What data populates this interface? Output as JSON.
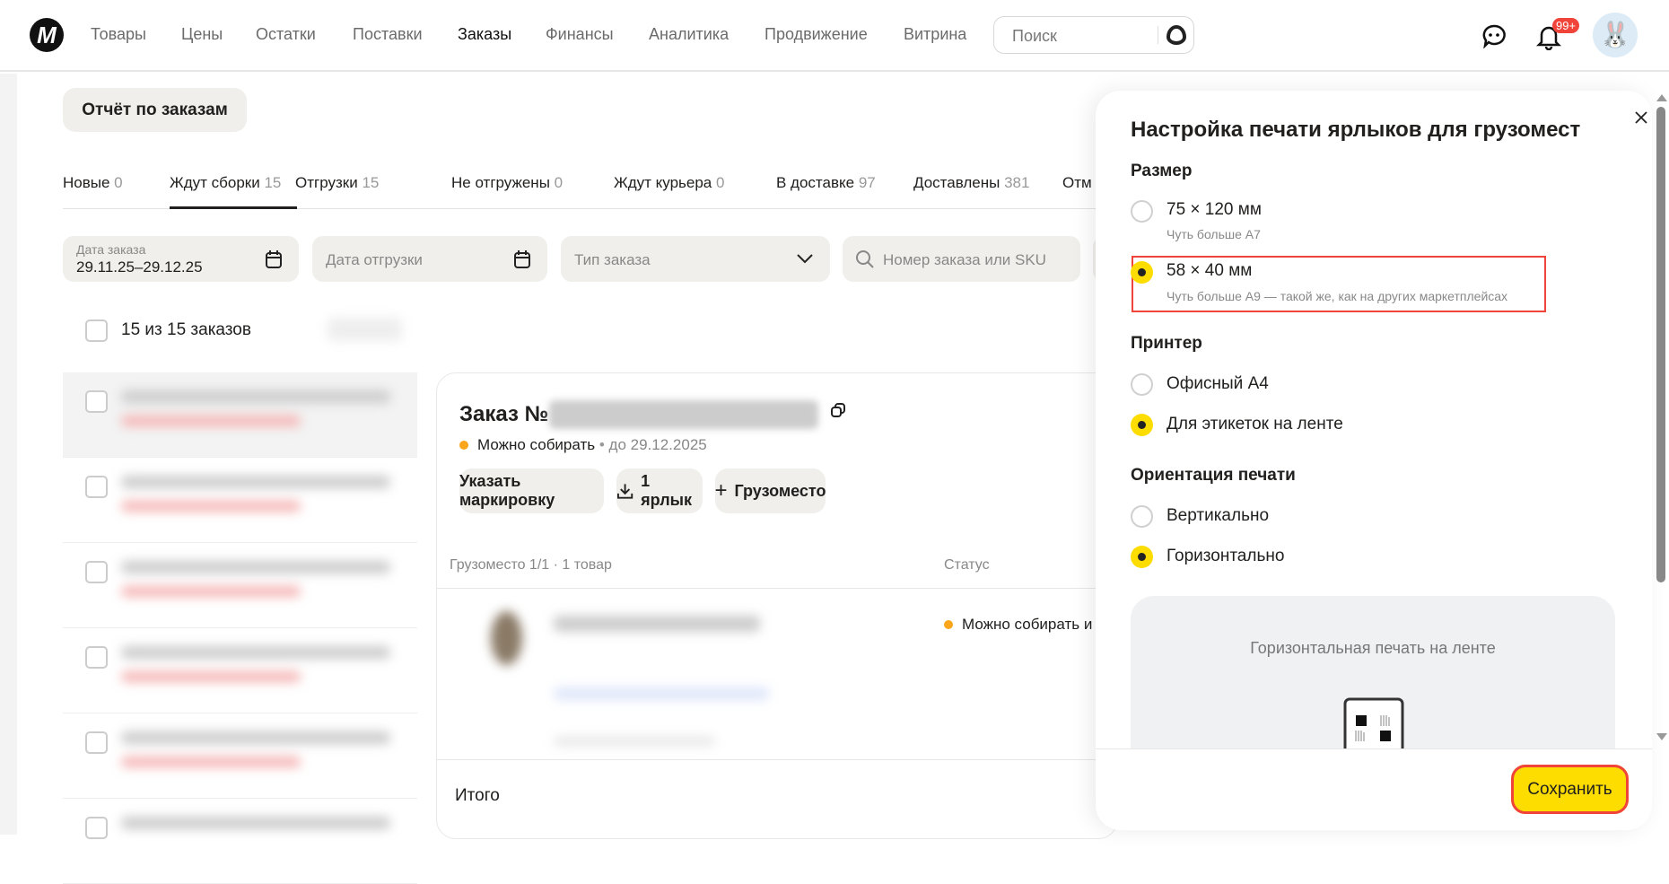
{
  "header": {
    "nav": [
      "Товары",
      "Цены",
      "Остатки",
      "Поставки",
      "Заказы",
      "Финансы",
      "Аналитика",
      "Продвижение",
      "Витрина"
    ],
    "active": "Заказы",
    "search_placeholder": "Поиск",
    "notifications_badge": "99+"
  },
  "report_button": "Отчёт по заказам",
  "tabs": [
    {
      "label": "Новые",
      "count": "0"
    },
    {
      "label": "Ждут сборки",
      "count": "15"
    },
    {
      "label": "Отгрузки",
      "count": "15"
    },
    {
      "label": "Не отгружены",
      "count": "0"
    },
    {
      "label": "Ждут курьера",
      "count": "0"
    },
    {
      "label": "В доставке",
      "count": "97"
    },
    {
      "label": "Доставлены",
      "count": "381"
    },
    {
      "label": "Отм",
      "count": ""
    }
  ],
  "filters": {
    "order_date_label": "Дата заказа",
    "order_date_value": "29.11.25–29.12.25",
    "ship_date_placeholder": "Дата отгрузки",
    "order_type_placeholder": "Тип заказа",
    "search_placeholder": "Номер заказа или SKU"
  },
  "select_all": "15 из 15 заказов",
  "order": {
    "title": "Заказ №",
    "status": "Можно собирать",
    "deadline": "до 29.12.2025",
    "buttons": {
      "marking": "Указать маркировку",
      "labels": "1 ярлык",
      "add_cargo": "Грузоместо"
    },
    "table_header": {
      "cargo": "Грузоместо 1/1",
      "items": "1 товар",
      "status": "Статус"
    },
    "row_status": "Можно собирать и",
    "total": "Итого"
  },
  "modal": {
    "title": "Настройка печати ярлыков для грузомест",
    "size_heading": "Размер",
    "sizes": [
      {
        "label": "75 × 120 мм",
        "sub": "Чуть больше A7",
        "selected": false
      },
      {
        "label": "58 × 40 мм",
        "sub": "Чуть больше A9 — такой же, как на других маркетплейсах",
        "selected": true
      }
    ],
    "printer_heading": "Принтер",
    "printers": [
      {
        "label": "Офисный A4",
        "selected": false
      },
      {
        "label": "Для этикеток на ленте",
        "selected": true
      }
    ],
    "orientation_heading": "Ориентация печати",
    "orientations": [
      {
        "label": "Вертикально",
        "selected": false
      },
      {
        "label": "Горизонтально",
        "selected": true
      }
    ],
    "preview_caption": "Горизонтальная печать на ленте",
    "save": "Сохранить"
  },
  "colors": {
    "accent": "#fddc00",
    "badge": "#f0443a",
    "status_dot": "#fba51a",
    "highlight": "#f0443a"
  }
}
